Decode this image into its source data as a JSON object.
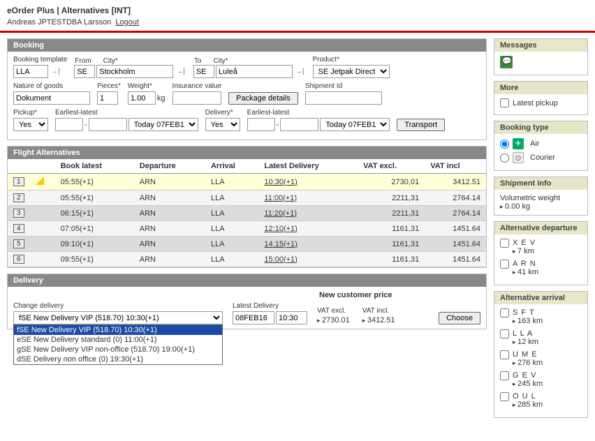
{
  "header": {
    "app_title": "eOrder Plus | Alternatives [INT]",
    "user": "Andreas JPTESTDBA Larsson",
    "logout": "Logout"
  },
  "booking": {
    "title": "Booking",
    "template_lbl": "Booking template",
    "template_val": "LLA",
    "from_lbl": "From",
    "from_country": "SE",
    "from_city_lbl": "City",
    "from_city": "Stockholm",
    "to_lbl": "To",
    "to_country": "SE",
    "to_city_lbl": "City",
    "to_city": "Luleå",
    "product_lbl": "Product",
    "product": "SE Jetpak Direct",
    "nature_lbl": "Nature of goods",
    "nature": "Dokument",
    "pieces_lbl": "Pieces",
    "pieces": "1",
    "weight_lbl": "Weight",
    "weight": "1.00",
    "weight_unit": "kg",
    "ins_lbl": "Insurance value",
    "ins": "",
    "pkg_btn": "Package details",
    "ship_lbl": "Shipment Id",
    "ship": "",
    "pickup_lbl": "Pickup",
    "pickup_sel": "Yes",
    "pickup_range_lbl": "Earliest-latest",
    "pickup_early": "",
    "pickup_late": "",
    "pickup_date": "Today 07FEB16",
    "delivery_lbl": "Delivery",
    "delivery_sel": "Yes",
    "delivery_range_lbl": "Earliest-latest",
    "delivery_early": "",
    "delivery_late": "",
    "delivery_date": "Today 07FEB16",
    "transport_btn": "Transport"
  },
  "flights": {
    "title": "Flight Alternatives",
    "cols": {
      "book": "Book latest",
      "dep": "Departure",
      "arr": "Arrival",
      "ld": "Latest Delivery",
      "vex": "VAT excl.",
      "vin": "VAT incl"
    },
    "rows": [
      {
        "n": "1",
        "book": "05:55(+1)",
        "dep": "ARN",
        "arr": "LLA",
        "ld": "10:30(+1)",
        "vex": "2730,01",
        "vin": "3412.51",
        "sel": true
      },
      {
        "n": "2",
        "book": "05:55(+1)",
        "dep": "ARN",
        "arr": "LLA",
        "ld": "11:00(+1)",
        "vex": "2211,31",
        "vin": "2764.14"
      },
      {
        "n": "3",
        "book": "06:15(+1)",
        "dep": "ARN",
        "arr": "LLA",
        "ld": "11:20(+1)",
        "vex": "2211,31",
        "vin": "2764.14"
      },
      {
        "n": "4",
        "book": "07:05(+1)",
        "dep": "ARN",
        "arr": "LLA",
        "ld": "12:10(+1)",
        "vex": "1161,31",
        "vin": "1451.64"
      },
      {
        "n": "5",
        "book": "09:10(+1)",
        "dep": "ARN",
        "arr": "LLA",
        "ld": "14:15(+1)",
        "vex": "1161,31",
        "vin": "1451.64"
      },
      {
        "n": "6",
        "book": "09:55(+1)",
        "dep": "ARN",
        "arr": "LLA",
        "ld": "15:00(+1)",
        "vex": "1161,31",
        "vin": "1451.64"
      }
    ]
  },
  "delivery": {
    "title": "Delivery",
    "ncp_lbl": "New customer price",
    "change_lbl": "Change delivery",
    "change_val": "fSE New Delivery VIP (518.70) 10:30(+1)",
    "options": [
      "fSE New Delivery VIP (518.70) 10:30(+1)",
      "eSE New Delivery standard (0) 11:00(+1)",
      "gSE New Delivery VIP non-office (518.70) 19:00(+1)",
      "dSE Delivery non office (0) 19:30(+1)"
    ],
    "ld_lbl": "Latest Delivery",
    "ld_date": "08FEB16",
    "ld_time": "10:30",
    "vex_lbl": "VAT excl.",
    "vex": "2730.01",
    "vin_lbl": "VAT incl.",
    "vin": "3412.51",
    "choose_btn": "Choose"
  },
  "side": {
    "messages_title": "Messages",
    "more_title": "More",
    "latest_pickup": "Latest pickup",
    "booking_type_title": "Booking type",
    "air": "Air",
    "courier": "Courier",
    "ship_title": "Shipment info",
    "vol_lbl": "Volumetric weight",
    "vol_val": "0.00 kg",
    "alt_dep_title": "Alternative departure",
    "alt_dep": [
      {
        "code": "X E V",
        "dist": "7 km"
      },
      {
        "code": "A R N",
        "dist": "41 km"
      }
    ],
    "alt_arr_title": "Alternative arrival",
    "alt_arr": [
      {
        "code": "S F T",
        "dist": "163 km"
      },
      {
        "code": "L L A",
        "dist": "12 km"
      },
      {
        "code": "U M E",
        "dist": "276 km"
      },
      {
        "code": "G E V",
        "dist": "245 km"
      },
      {
        "code": "O U L",
        "dist": "285 km"
      }
    ]
  }
}
